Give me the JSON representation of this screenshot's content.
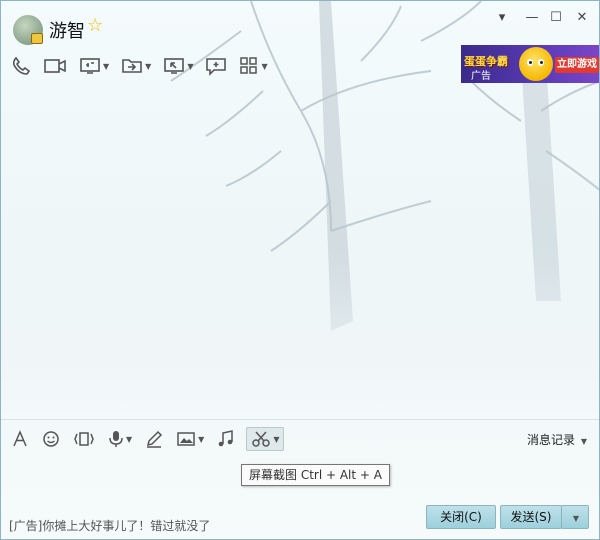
{
  "contact": {
    "name": "游智"
  },
  "ad_banner": {
    "game_name": "蛋蛋争霸",
    "tag": "广告",
    "cta": "立即游戏"
  },
  "input_bar": {
    "history_label": "消息记录"
  },
  "tooltip": {
    "text": "屏幕截图 Ctrl + Alt + A"
  },
  "footer": {
    "ad_text": "[广告]你摊上大好事儿了！错过就没了",
    "close_label": "关闭(C)",
    "send_label": "发送(S)"
  },
  "colors": {
    "accent_button": "#a8d8e4",
    "vip_star": "#f2b900"
  }
}
